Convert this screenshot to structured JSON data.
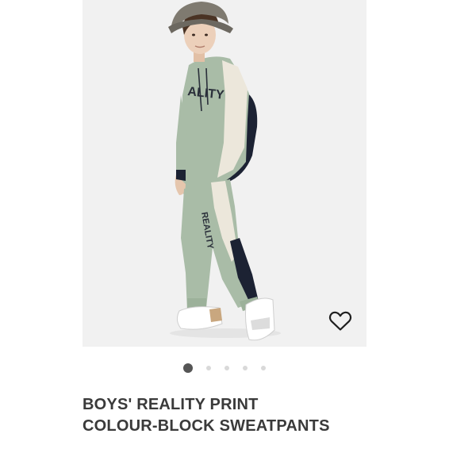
{
  "product": {
    "title_lines": [
      "BOYS' REALITY PRINT",
      "COLOUR-BLOCK SWEATPANTS"
    ],
    "print_text_hoodie": "ALITY",
    "print_text_pants": "REALITY"
  },
  "wishlist": {
    "icon": "heart-outline-icon"
  },
  "carousel": {
    "count": 5,
    "active_index": 0
  },
  "colors": {
    "image_bg": "#f1f1f1",
    "sage": "#a9bca7",
    "cream": "#ece7db",
    "navy": "#1c2233",
    "title_text": "#3a3a3a",
    "dot_active": "#555555",
    "dot_inactive": "#d9d9d9"
  }
}
